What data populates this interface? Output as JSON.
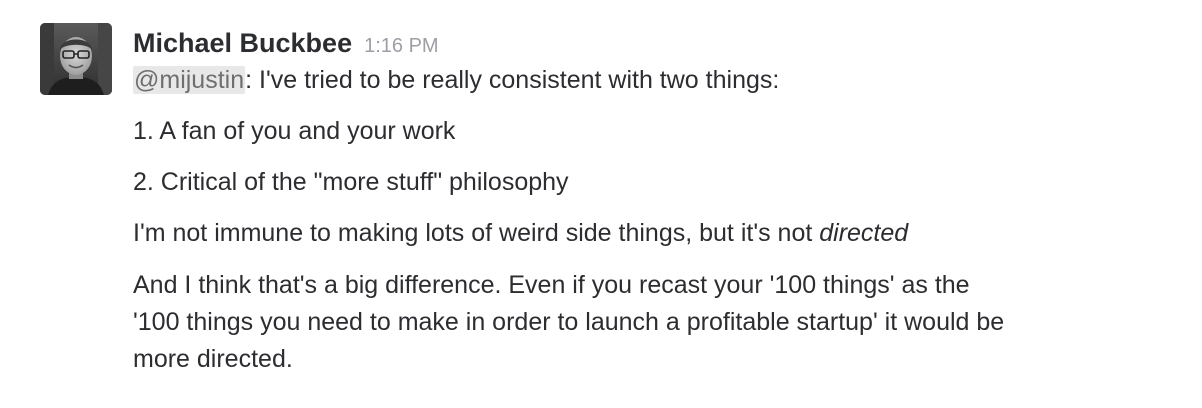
{
  "message": {
    "sender": "Michael Buckbee",
    "timestamp": "1:16 PM",
    "mention": "@mijustin",
    "first_line_rest": ": I've tried to be really consistent with two things:",
    "list": [
      "1. A fan of you and your work",
      "2. Critical of the \"more stuff\" philosophy"
    ],
    "not_immune": {
      "text": "I'm not immune to making lots of weird side things, but it's not ",
      "emphasis": "directed"
    },
    "difference_lines": [
      "And I think that's a big difference. Even if you recast your '100 things' as the",
      "'100 things you need to make in order to launch a profitable startup' it would be",
      "more directed."
    ]
  },
  "avatar": {
    "icon": "user-avatar-photo"
  }
}
